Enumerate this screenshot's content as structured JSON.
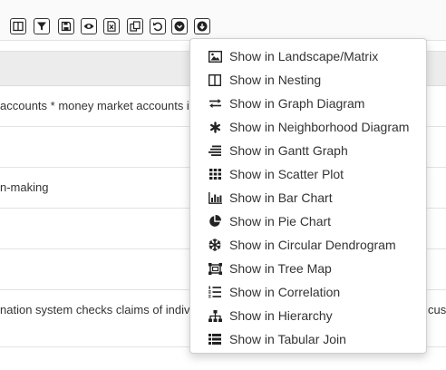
{
  "toolbar": {
    "buttons": [
      {
        "icon": "columns-icon"
      },
      {
        "icon": "filter-icon"
      },
      {
        "icon": "save-icon"
      },
      {
        "icon": "eye-icon"
      },
      {
        "icon": "excel-export-icon"
      },
      {
        "icon": "copy-icon"
      },
      {
        "icon": "undo-icon"
      },
      {
        "icon": "chevron-down-circle-icon"
      },
      {
        "icon": "arrow-down-circle-icon"
      }
    ]
  },
  "table": {
    "rows": [
      {
        "text": "accounts * money market accounts i",
        "right": ""
      },
      {
        "text": "",
        "right": ""
      },
      {
        "text": "n-making",
        "right": ""
      },
      {
        "text": "",
        "right": ""
      },
      {
        "text": "",
        "right": ""
      },
      {
        "text": "nation system checks claims of indivi",
        "right": "cust"
      },
      {
        "text": "",
        "right": ""
      }
    ]
  },
  "menu": {
    "items": [
      {
        "label": "Show in Landscape/Matrix",
        "icon": "image-icon"
      },
      {
        "label": "Show in Nesting",
        "icon": "nesting-icon"
      },
      {
        "label": "Show in Graph Diagram",
        "icon": "exchange-arrows-icon"
      },
      {
        "label": "Show in Neighborhood Diagram",
        "icon": "asterisk-icon"
      },
      {
        "label": "Show in Gantt Graph",
        "icon": "gantt-icon"
      },
      {
        "label": "Show in Scatter Plot",
        "icon": "grid-dots-icon"
      },
      {
        "label": "Show in Bar Chart",
        "icon": "bar-chart-icon"
      },
      {
        "label": "Show in Pie Chart",
        "icon": "pie-chart-icon"
      },
      {
        "label": "Show in Circular Dendrogram",
        "icon": "snowflake-icon"
      },
      {
        "label": "Show in Tree Map",
        "icon": "tree-map-icon"
      },
      {
        "label": "Show in Correlation",
        "icon": "numbered-list-icon"
      },
      {
        "label": "Show in Hierarchy",
        "icon": "sitemap-icon"
      },
      {
        "label": "Show in Tabular Join",
        "icon": "list-table-icon"
      }
    ]
  }
}
